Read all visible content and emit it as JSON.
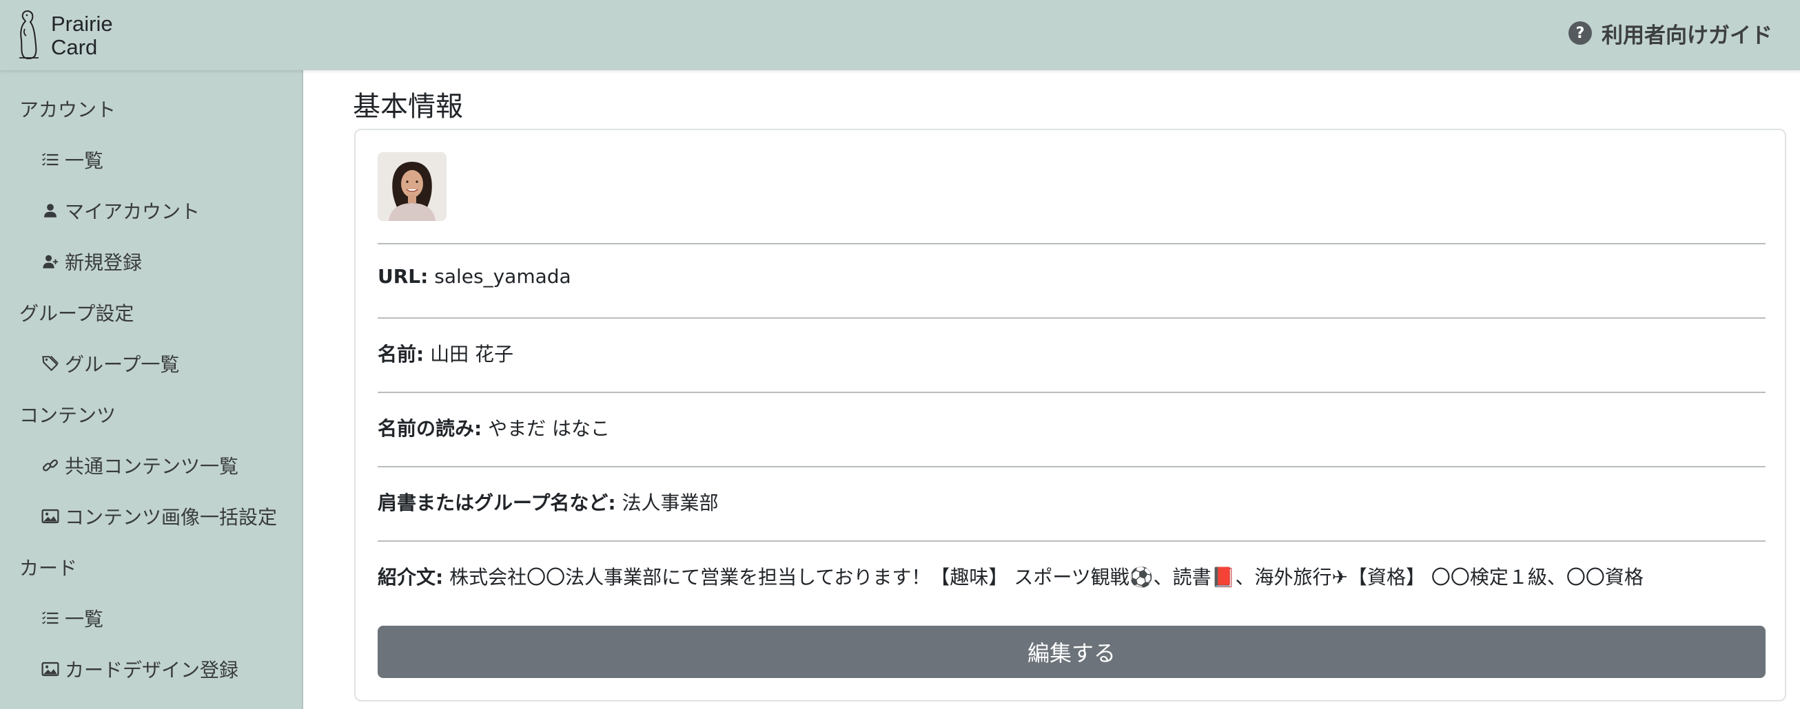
{
  "header": {
    "logo_line1": "Prairie",
    "logo_line2": "Card",
    "guide_icon": "?",
    "guide_label": "利用者向けガイド"
  },
  "sidebar": {
    "sections": [
      {
        "label": "アカウント",
        "items": [
          {
            "label": "一覧",
            "icon": "list-icon"
          },
          {
            "label": "マイアカウント",
            "icon": "person-icon"
          },
          {
            "label": "新規登録",
            "icon": "person-add-icon"
          }
        ]
      },
      {
        "label": "グループ設定",
        "items": [
          {
            "label": "グループ一覧",
            "icon": "tag-icon"
          }
        ]
      },
      {
        "label": "コンテンツ",
        "items": [
          {
            "label": "共通コンテンツ一覧",
            "icon": "link-icon"
          },
          {
            "label": "コンテンツ画像一括設定",
            "icon": "image-icon"
          }
        ]
      },
      {
        "label": "カード",
        "items": [
          {
            "label": "一覧",
            "icon": "list-icon"
          },
          {
            "label": "カードデザイン登録",
            "icon": "image-icon"
          }
        ]
      }
    ]
  },
  "main": {
    "title": "基本情報",
    "fields": [
      {
        "label": "URL:",
        "value": "sales_yamada"
      },
      {
        "label": "名前:",
        "value": "山田 花子"
      },
      {
        "label": "名前の読み:",
        "value": "やまだ はなこ"
      },
      {
        "label": "肩書またはグループ名など:",
        "value": "法人事業部"
      },
      {
        "label": "紹介文:",
        "value": "株式会社〇〇法人事業部にて営業を担当しております！【趣味】 スポーツ観戦⚽、読書📕、海外旅行✈【資格】 〇〇検定１級、〇〇資格"
      }
    ],
    "edit_label": "編集する"
  },
  "colors": {
    "header_bg": "#c1d3cf",
    "sidebar_bg": "#c1d3cf",
    "button_bg": "#6c737a"
  }
}
